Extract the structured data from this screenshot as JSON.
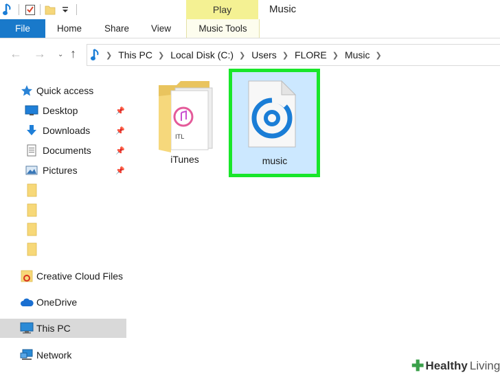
{
  "window": {
    "title": "Music",
    "contextual_tab": "Play"
  },
  "ribbon": {
    "tabs": [
      "File",
      "Home",
      "Share",
      "View",
      "Music Tools"
    ]
  },
  "address": {
    "breadcrumbs": [
      "This PC",
      "Local Disk (C:)",
      "Users",
      "FLORE",
      "Music"
    ]
  },
  "nav": {
    "quick_access": "Quick access",
    "pinned": [
      "Desktop",
      "Downloads",
      "Documents",
      "Pictures"
    ],
    "creative_cloud": "Creative Cloud Files",
    "onedrive": "OneDrive",
    "this_pc": "This PC",
    "network": "Network"
  },
  "files": [
    {
      "name": "iTunes",
      "type": "folder",
      "icon": "itunes-folder-icon"
    },
    {
      "name": "music",
      "type": "groove-music-file",
      "icon": "groove-music-icon",
      "selected": true
    }
  ],
  "watermark": {
    "brand_bold": "Healthy",
    "brand_light": "Living"
  },
  "colors": {
    "file_tab": "#1979ca",
    "play_tab": "#f4f193",
    "selection_bg": "#cce8ff",
    "highlight": "#19e62a",
    "groove_blue": "#1a7dd6"
  }
}
